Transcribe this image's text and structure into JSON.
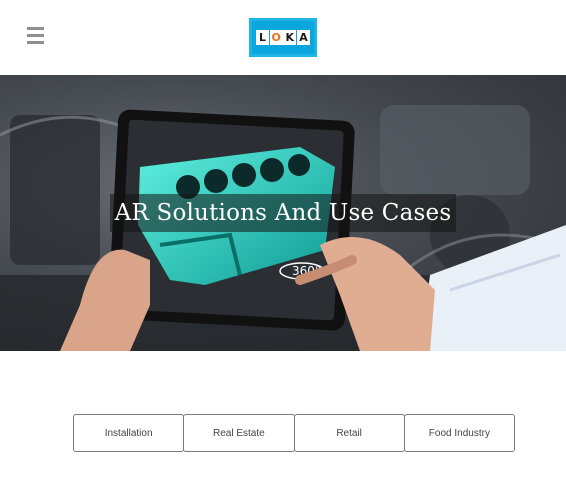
{
  "header": {
    "logo_letters": [
      "L",
      "O",
      "K",
      "A"
    ],
    "logo_colors": {
      "frame": "#1fb4e6",
      "accent": "#f26b1d"
    },
    "menu_icon": "hamburger-icon"
  },
  "hero": {
    "title": "AR Solutions And Use Cases",
    "rotate_label": "360°"
  },
  "tabs": [
    {
      "label": "Installation"
    },
    {
      "label": "Real Estate"
    },
    {
      "label": "Retail"
    },
    {
      "label": "Food Industry"
    }
  ]
}
